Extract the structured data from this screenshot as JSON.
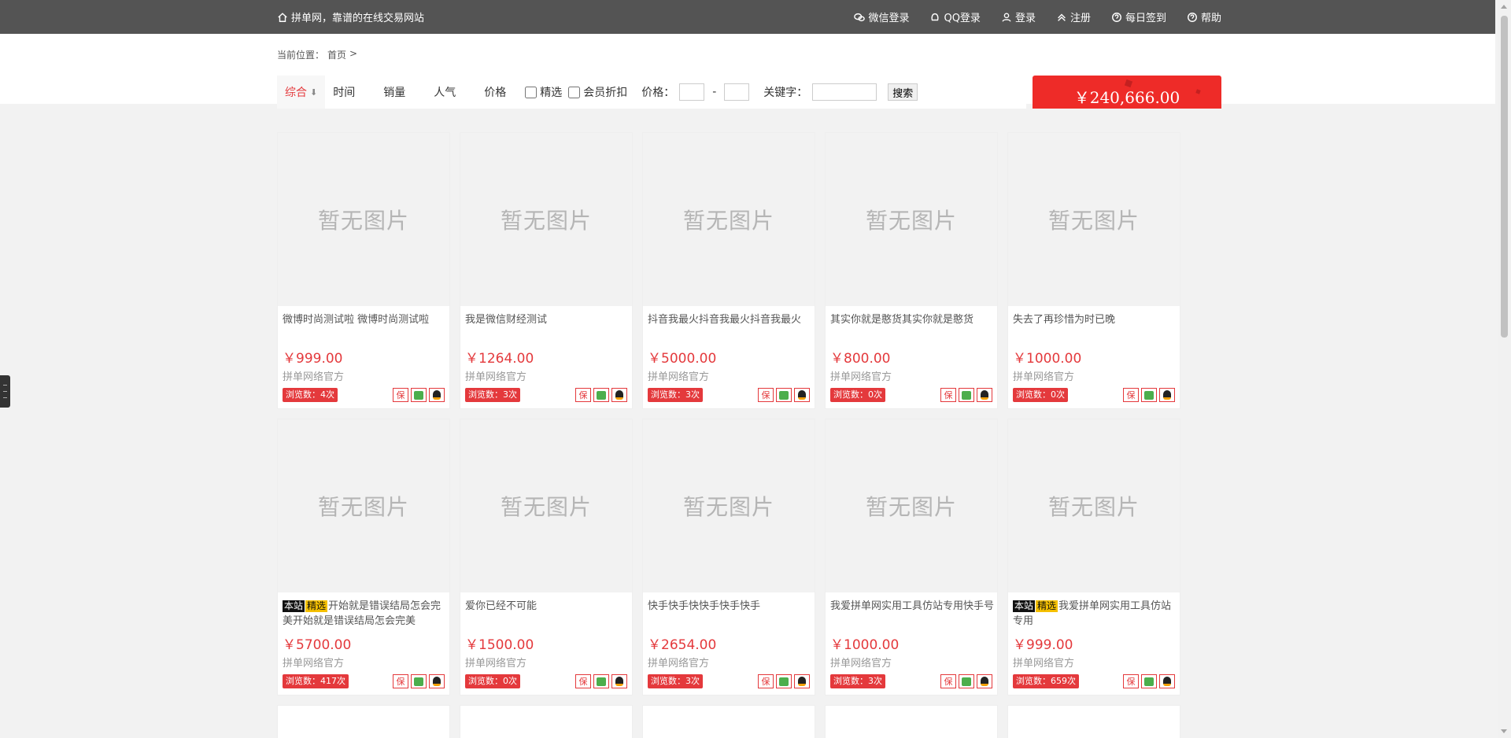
{
  "header": {
    "slogan": "拼单网，靠谱的在线交易网站",
    "links": [
      {
        "label": "微信登录",
        "icon": "wechat-icon"
      },
      {
        "label": "QQ登录",
        "icon": "qq-icon"
      },
      {
        "label": "登录",
        "icon": "user-icon"
      },
      {
        "label": "注册",
        "icon": "chevron-up-icon"
      },
      {
        "label": "每日签到",
        "icon": "question-circle-icon"
      },
      {
        "label": "帮助",
        "icon": "question-circle-icon"
      }
    ]
  },
  "breadcrumb": {
    "prefix": "当前位置：",
    "home": "首页",
    "sep": ">"
  },
  "filters": {
    "sorts": [
      "综合",
      "时间",
      "销量",
      "人气",
      "价格"
    ],
    "sort_arrow": "⬇",
    "checks": [
      "精选",
      "会员折扣"
    ],
    "price_label": "价格：",
    "dash": "-",
    "keyword_label": "关键字：",
    "search_label": "搜索"
  },
  "banner": {
    "amount": "￥240,666.00"
  },
  "colors": {
    "accent": "#e4393c",
    "topbar": "#545454",
    "banner": "#ee2b28"
  },
  "no_image_text": "暂无图片",
  "badge_site": "本站",
  "badge_pick": "精选",
  "badge_bao": "保",
  "products": [
    {
      "title": "微博时尚测试啦 微博时尚测试啦",
      "price": "￥999.00",
      "shop": "拼单网络官方",
      "views": "浏览数：4次",
      "featured": false
    },
    {
      "title": "我是微信财经测试",
      "price": "￥1264.00",
      "shop": "拼单网络官方",
      "views": "浏览数：3次",
      "featured": false
    },
    {
      "title": "抖音我最火抖音我最火抖音我最火",
      "price": "￥5000.00",
      "shop": "拼单网络官方",
      "views": "浏览数：3次",
      "featured": false
    },
    {
      "title": "其实你就是憨货其实你就是憨货",
      "price": "￥800.00",
      "shop": "拼单网络官方",
      "views": "浏览数：0次",
      "featured": false
    },
    {
      "title": "失去了再珍惜为时已晚",
      "price": "￥1000.00",
      "shop": "拼单网络官方",
      "views": "浏览数：0次",
      "featured": false
    },
    {
      "title": "开始就是错误结局怎会完美开始就是错误结局怎会完美",
      "price": "￥5700.00",
      "shop": "拼单网络官方",
      "views": "浏览数：417次",
      "featured": true
    },
    {
      "title": "爱你已经不可能",
      "price": "￥1500.00",
      "shop": "拼单网络官方",
      "views": "浏览数：0次",
      "featured": false
    },
    {
      "title": "快手快手快快手快手快手",
      "price": "￥2654.00",
      "shop": "拼单网络官方",
      "views": "浏览数：3次",
      "featured": false
    },
    {
      "title": "我爱拼单网实用工具仿站专用快手号",
      "price": "￥1000.00",
      "shop": "拼单网络官方",
      "views": "浏览数：3次",
      "featured": false
    },
    {
      "title": "我爱拼单网实用工具仿站专用",
      "price": "￥999.00",
      "shop": "拼单网络官方",
      "views": "浏览数：659次",
      "featured": true
    }
  ]
}
